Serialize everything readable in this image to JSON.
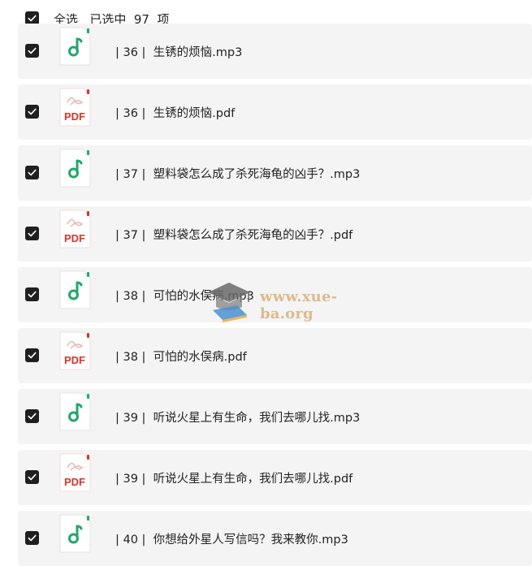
{
  "header": {
    "select_all_label": "全选",
    "selected_text": "已选中  97  项"
  },
  "files": [
    {
      "name": "| 36 |  生锈的烦恼.mp3",
      "type": "audio-file-icon"
    },
    {
      "name": "| 36 |  生锈的烦恼.pdf",
      "type": "pdf-file-icon"
    },
    {
      "name": "| 37 |  塑料袋怎么成了杀死海龟的凶手？.mp3",
      "type": "audio-file-icon"
    },
    {
      "name": "| 37 |  塑料袋怎么成了杀死海龟的凶手？.pdf",
      "type": "pdf-file-icon"
    },
    {
      "name": "| 38 |  可怕的水俣病.mp3",
      "type": "audio-file-icon"
    },
    {
      "name": "| 38 |  可怕的水俣病.pdf",
      "type": "pdf-file-icon"
    },
    {
      "name": "| 39 |  听说火星上有生命，我们去哪儿找.mp3",
      "type": "audio-file-icon"
    },
    {
      "name": "| 39 |  听说火星上有生命，我们去哪儿找.pdf",
      "type": "pdf-file-icon"
    },
    {
      "name": "| 40 |  你想给外星人写信吗？我来教你.mp3",
      "type": "audio-file-icon"
    }
  ],
  "pdf_badge": "PDF",
  "watermark": "www.xue-ba.org",
  "colors": {
    "row_bg": "#f4f4f5",
    "checkbox": "#1f1f1f",
    "audio_accent": "#1fa86a",
    "pdf_accent": "#d9342b"
  }
}
